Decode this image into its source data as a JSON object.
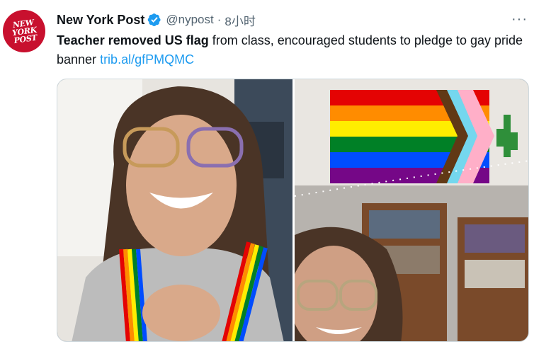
{
  "tweet": {
    "author_name": "New York Post",
    "handle": "@nypost",
    "separator": "·",
    "time": "8小时",
    "more": "···",
    "text_bold": "Teacher removed US flag",
    "text_rest": " from class, encouraged students to pledge to gay pride banner ",
    "link": "trib.al/gfPMQMC"
  },
  "avatar": {
    "line1": "NEW",
    "line2": "YORK",
    "line3": "POST"
  },
  "colors": {
    "brand": "#c8102e",
    "link": "#1d9bf0",
    "verified": "#1d9bf0",
    "secondary_text": "#536471"
  },
  "icons": {
    "verified": "verified-badge-icon",
    "more": "more-horizontal-icon"
  }
}
